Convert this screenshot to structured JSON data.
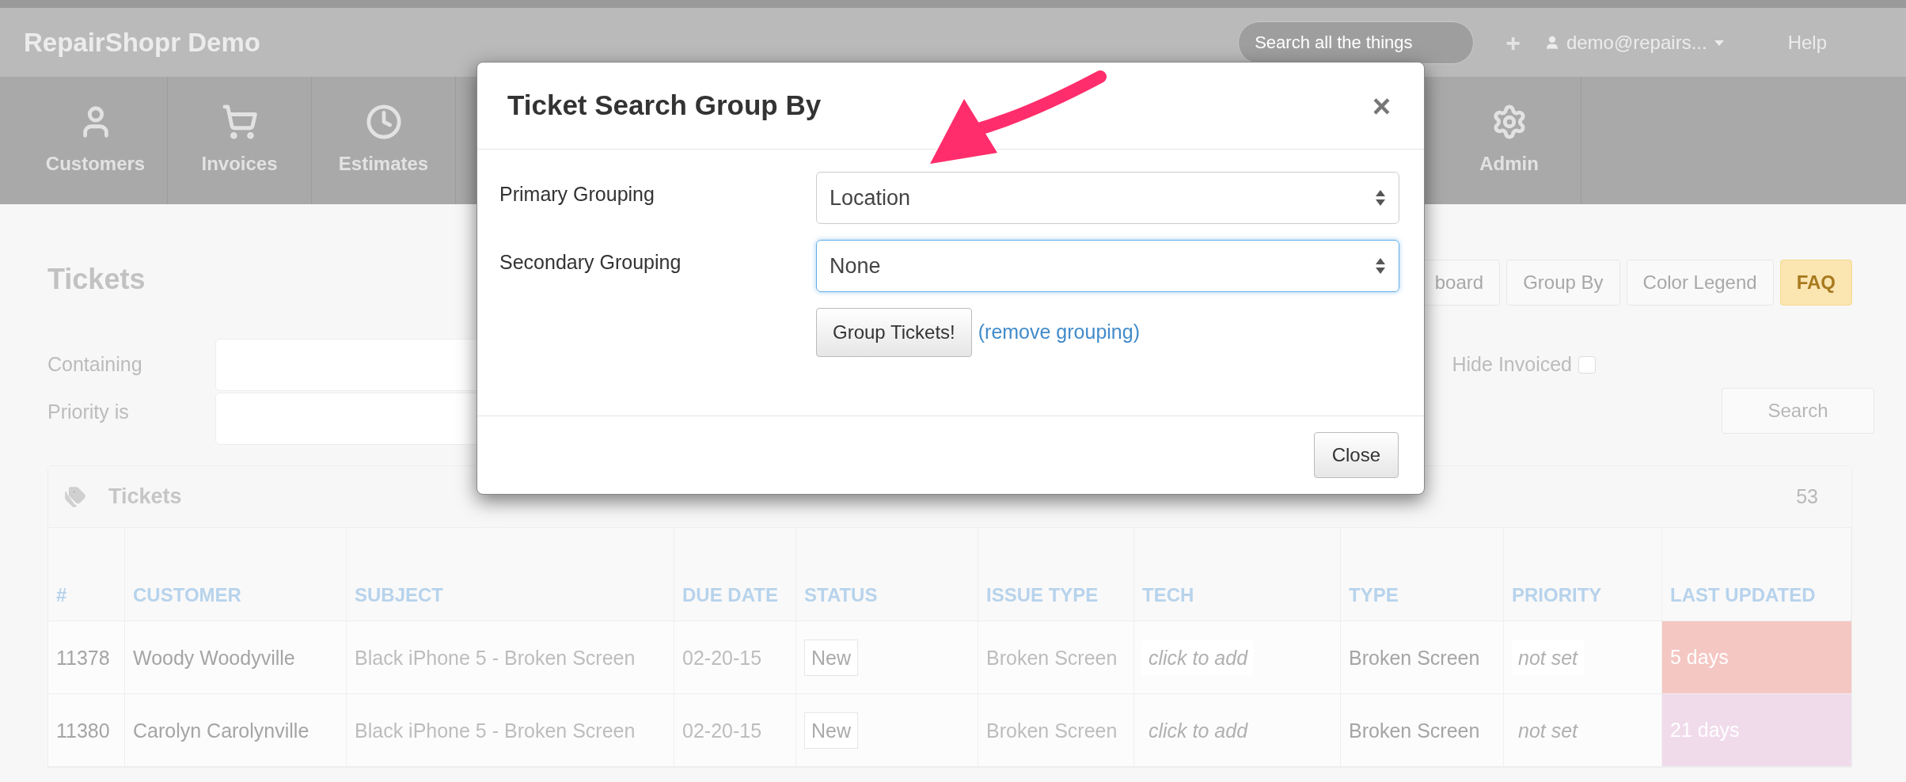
{
  "navbar": {
    "brand": "RepairShopr Demo",
    "search": {
      "placeholder": "Search all the things"
    },
    "add": "+",
    "user": "demo@repairs...",
    "help": "Help"
  },
  "nav_items": [
    {
      "label": "Customers",
      "kind": "user"
    },
    {
      "label": "Invoices",
      "kind": "cart"
    },
    {
      "label": "Estimates",
      "kind": "clock"
    },
    {
      "label": "Admin",
      "kind": "gear"
    }
  ],
  "page": {
    "title": "Tickets",
    "toolbar_buttons": [
      {
        "label": "board",
        "kind": "default"
      },
      {
        "label": "Group By",
        "kind": "default"
      },
      {
        "label": "Color Legend",
        "kind": "default"
      },
      {
        "label": "FAQ",
        "kind": "warning"
      }
    ],
    "containing_label": "Containing",
    "priority_label": "Priority is",
    "hide_invoiced": {
      "label": "Hide Invoiced",
      "checked": false
    },
    "search_button": "Search"
  },
  "table": {
    "title": "Tickets",
    "count": "53",
    "columns": [
      "#",
      "CUSTOMER",
      "SUBJECT",
      "DUE DATE",
      "STATUS",
      "ISSUE TYPE",
      "TECH",
      "TYPE",
      "PRIORITY",
      "LAST UPDATED"
    ],
    "rows": [
      {
        "id": "11378",
        "customer": "Woody Woodyville",
        "subject": "Black iPhone 5 - Broken Screen",
        "due_date": "02-20-15",
        "status": "New",
        "issue_type": "Broken Screen",
        "tech": "click to add",
        "type": "Broken Screen",
        "priority": "not set",
        "last_updated": "5 days",
        "color": "#f4c7c3"
      },
      {
        "id": "11380",
        "customer": "Carolyn Carolynville",
        "subject": "Black iPhone 5 - Broken Screen",
        "due_date": "02-20-15",
        "status": "New",
        "issue_type": "Broken Screen",
        "tech": "click to add",
        "type": "Broken Screen",
        "priority": "not set",
        "last_updated": "21 days",
        "color": "#f0dbeb"
      }
    ]
  },
  "modal": {
    "title": "Ticket Search Group By",
    "close_icon": "×",
    "fields": [
      {
        "label": "Primary Grouping",
        "value": "Location",
        "focused": false
      },
      {
        "label": "Secondary Grouping",
        "value": "None",
        "focused": true
      }
    ],
    "group_button": "Group Tickets!",
    "remove_link": "(remove grouping)",
    "close_button": "Close"
  }
}
